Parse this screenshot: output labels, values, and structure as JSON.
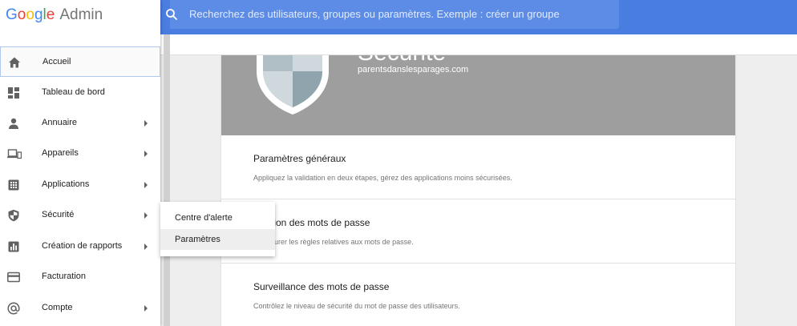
{
  "app": {
    "logo_google_letters": [
      "G",
      "o",
      "o",
      "g",
      "l",
      "e"
    ],
    "logo_product": "Admin"
  },
  "search": {
    "placeholder": "Recherchez des utilisateurs, groupes ou paramètres. Exemple : créer un groupe"
  },
  "sidebar": {
    "items": [
      {
        "label": "Accueil",
        "icon": "home-icon",
        "has_submenu": false,
        "active": true
      },
      {
        "label": "Tableau de bord",
        "icon": "dashboard-icon",
        "has_submenu": false
      },
      {
        "label": "Annuaire",
        "icon": "person-icon",
        "has_submenu": true
      },
      {
        "label": "Appareils",
        "icon": "devices-icon",
        "has_submenu": true
      },
      {
        "label": "Applications",
        "icon": "apps-grid-icon",
        "has_submenu": true
      },
      {
        "label": "Sécurité",
        "icon": "shield-icon",
        "has_submenu": true
      },
      {
        "label": "Création de rapports",
        "icon": "bar-chart-icon",
        "has_submenu": true
      },
      {
        "label": "Facturation",
        "icon": "credit-card-icon",
        "has_submenu": false
      },
      {
        "label": "Compte",
        "icon": "at-sign-icon",
        "has_submenu": true
      }
    ]
  },
  "submenu": {
    "items": [
      {
        "label": "Centre d'alerte"
      },
      {
        "label": "Paramètres",
        "hovered": true
      }
    ]
  },
  "main": {
    "hero_title": "Sécurité",
    "domain": "parentsdanslesparages.com",
    "sections": [
      {
        "title": "Paramètres généraux",
        "description": "Appliquez la validation en deux étapes, gérez des applications moins sécurisées."
      },
      {
        "title": "Gestion des mots de passe",
        "description": "Configurer les règles relatives aux mots de passe."
      },
      {
        "title": "Surveillance des mots de passe",
        "description": "Contrôlez le niveau de sécurité du mot de passe des utilisateurs."
      }
    ]
  },
  "colors": {
    "topbar": "#4a7de0",
    "hero": "#9e9e9e",
    "active_border": "#b3c8ef"
  }
}
